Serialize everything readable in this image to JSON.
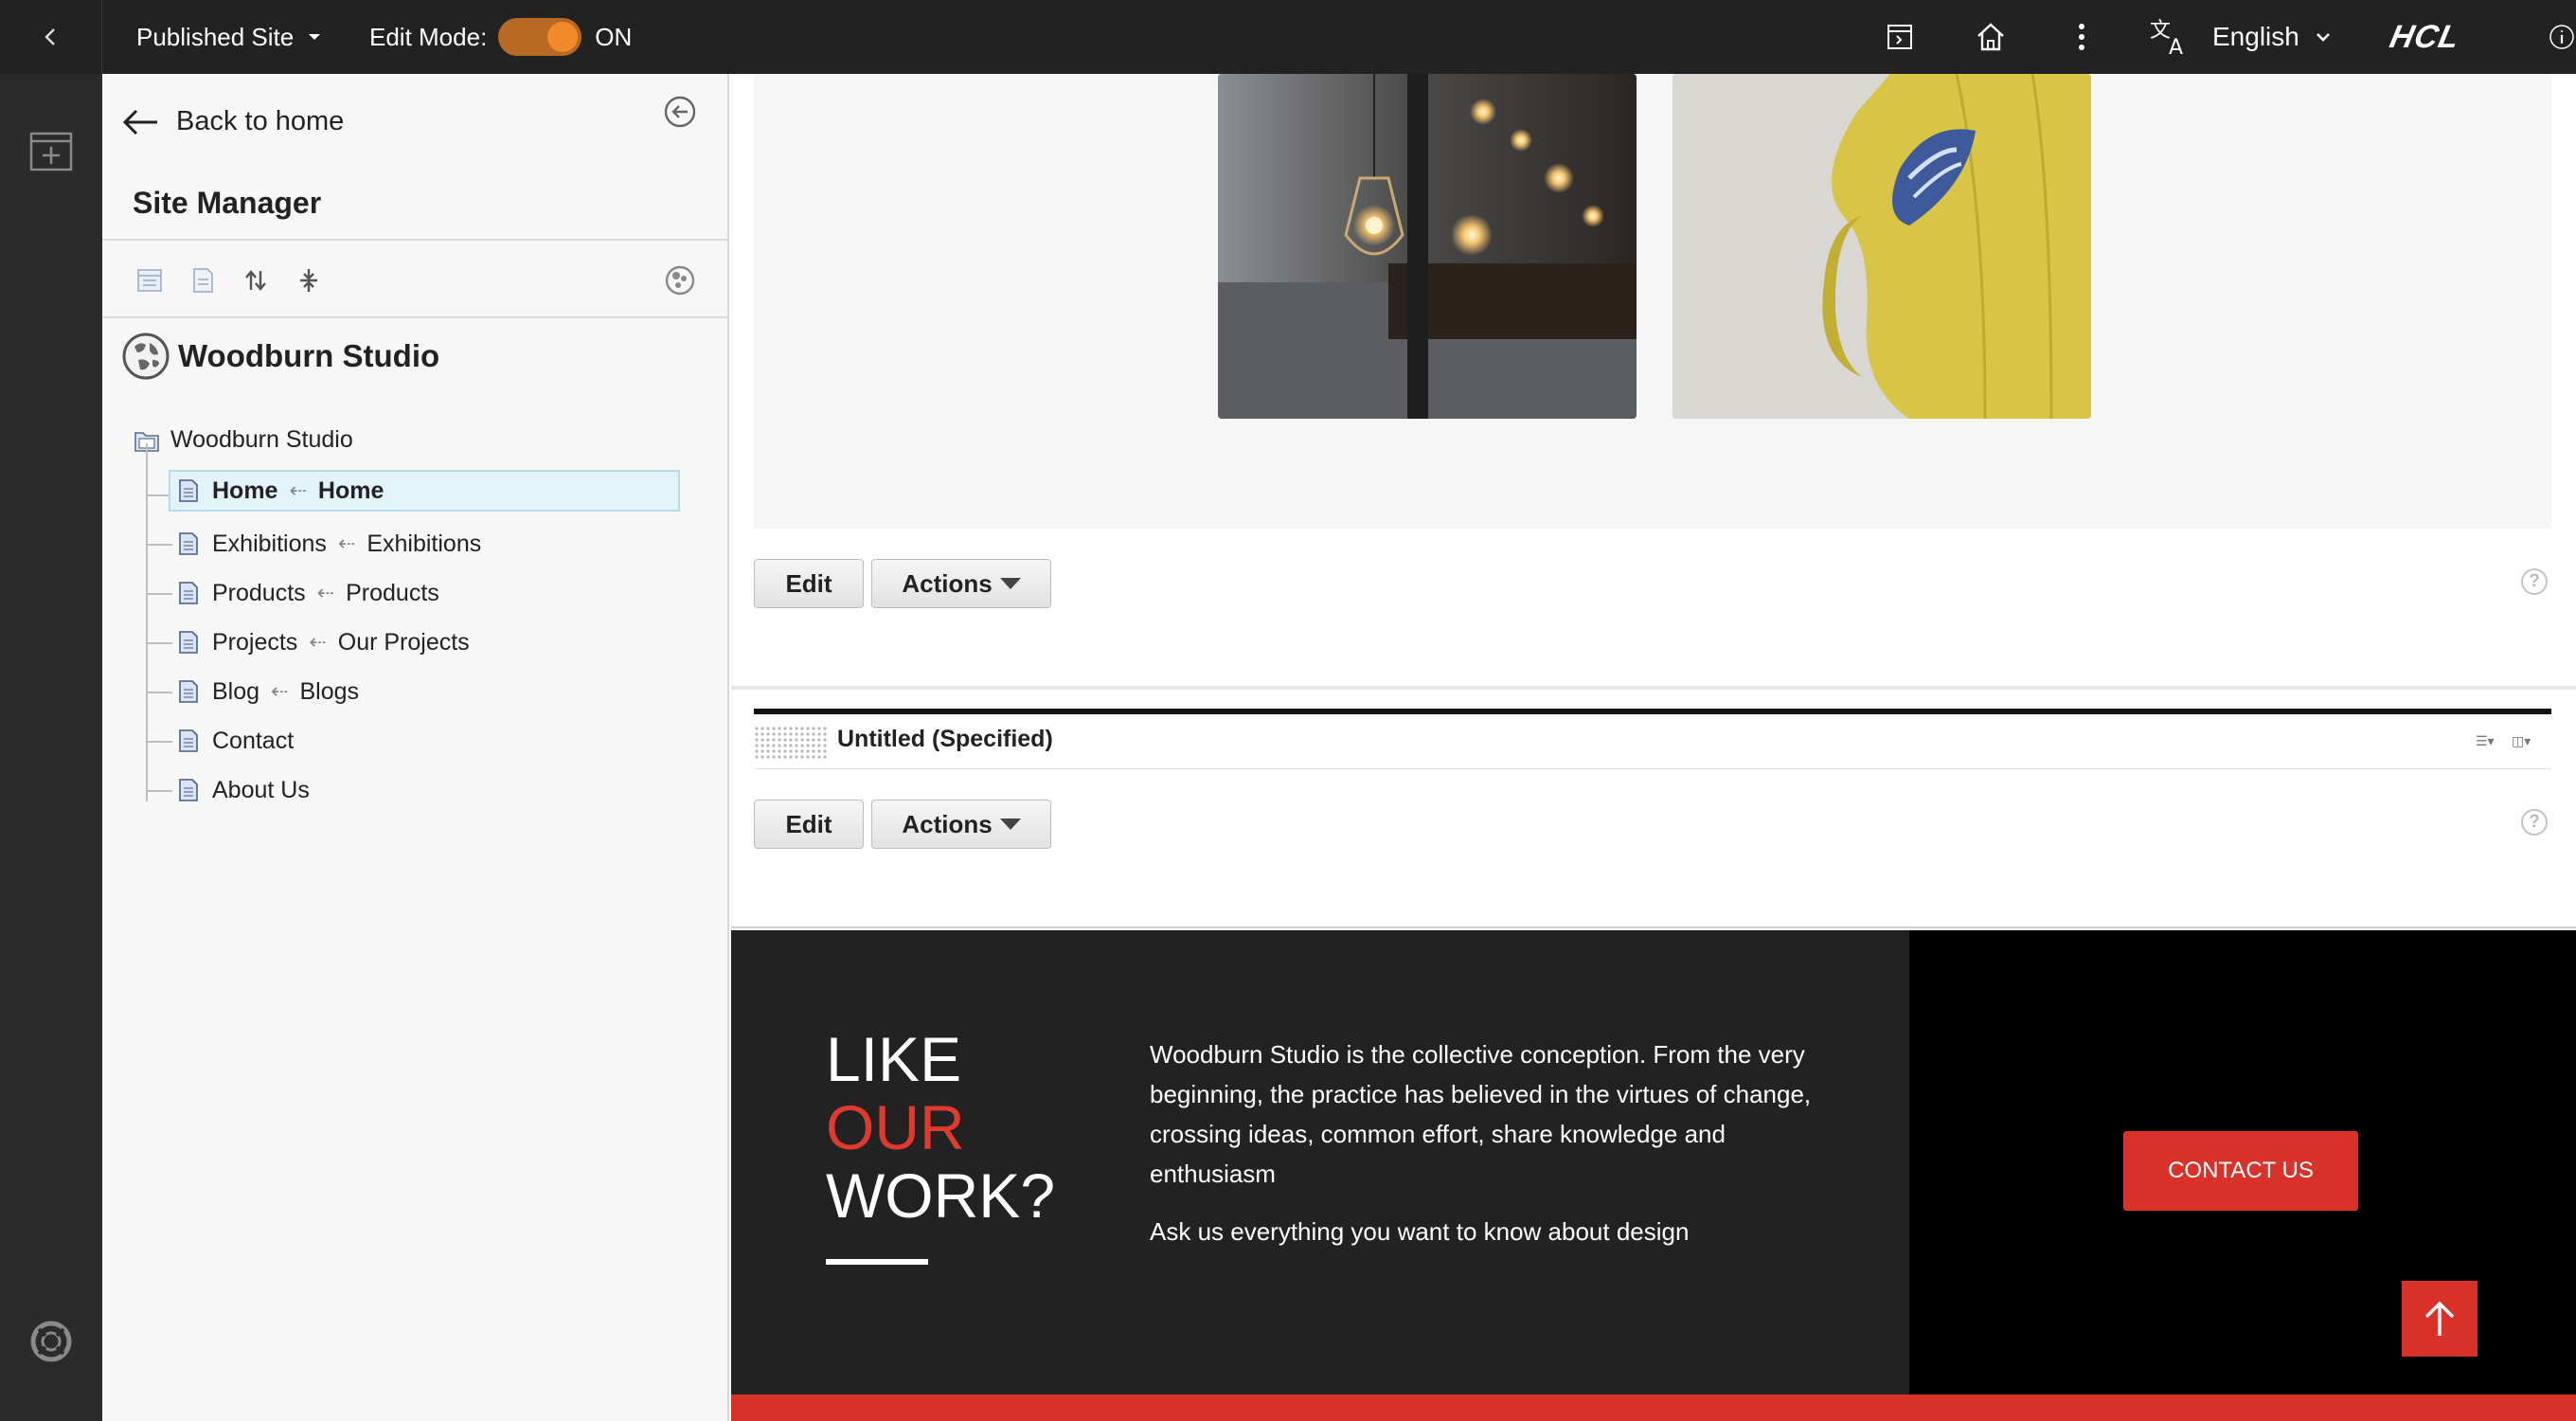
{
  "topbar": {
    "site_selector": "Published Site",
    "edit_mode_label": "Edit Mode:",
    "edit_mode_state": "ON",
    "language": "English",
    "brand": "HCL"
  },
  "site_manager": {
    "back_label": "Back to home",
    "title": "Site Manager",
    "site_name": "Woodburn Studio",
    "tree_root": "Woodburn Studio",
    "pages": [
      {
        "label": "Home",
        "target": "Home"
      },
      {
        "label": "Exhibitions",
        "target": "Exhibitions"
      },
      {
        "label": "Products",
        "target": "Products"
      },
      {
        "label": "Projects",
        "target": "Our Projects"
      },
      {
        "label": "Blog",
        "target": "Blogs"
      },
      {
        "label": "Contact",
        "target": ""
      },
      {
        "label": "About Us",
        "target": ""
      }
    ]
  },
  "content": {
    "edit_label": "Edit",
    "actions_label": "Actions",
    "help_glyph": "?",
    "untitled_title": "Untitled (Specified)"
  },
  "footer": {
    "like_1": "LIKE",
    "like_2": "OUR",
    "like_3": "WORK?",
    "body": "Woodburn Studio is the collective conception. From the very beginning, the practice has believed in the virtues of change, crossing ideas, common effort, share knowledge and enthusiasm",
    "ask": "Ask us everything you want to know about design",
    "contact_label": "CONTACT US"
  },
  "colors": {
    "accent_red": "#d8322a",
    "toggle_orange": "#f08a2a",
    "dark": "#222222"
  }
}
